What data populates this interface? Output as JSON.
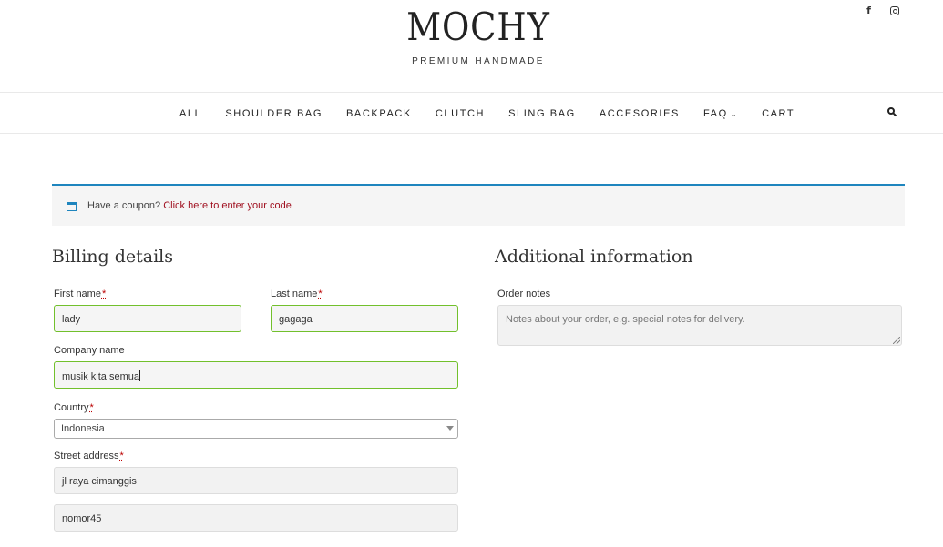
{
  "social": {
    "facebook_icon": "facebook-icon",
    "instagram_icon": "instagram-icon"
  },
  "brand": {
    "name": "MOCHY",
    "tagline": "PREMIUM HANDMADE"
  },
  "nav": {
    "items": [
      {
        "label": "ALL"
      },
      {
        "label": "SHOULDER BAG"
      },
      {
        "label": "BACKPACK"
      },
      {
        "label": "CLUTCH"
      },
      {
        "label": "SLING BAG"
      },
      {
        "label": "ACCESORIES"
      },
      {
        "label": "FAQ",
        "chevron": "⌄"
      },
      {
        "label": "CART"
      }
    ],
    "search_icon": "search-icon"
  },
  "coupon": {
    "text": "Have a coupon?",
    "link": "Click here to enter your code",
    "accent": "#1e85be",
    "link_color": "#a01020"
  },
  "billing": {
    "title": "Billing details",
    "first_name": {
      "label": "First name",
      "required": "*",
      "value": "lady"
    },
    "last_name": {
      "label": "Last name",
      "required": "*",
      "value": "gagaga"
    },
    "company": {
      "label": "Company name",
      "value": "musik kita semua"
    },
    "country": {
      "label": "Country",
      "required": "*",
      "value": "Indonesia"
    },
    "street": {
      "label": "Street address",
      "required": "*",
      "line1": "jl raya cimanggis",
      "line2": "nomor45"
    },
    "valid_color": "#72c02c"
  },
  "additional": {
    "title": "Additional information",
    "order_notes": {
      "label": "Order notes",
      "placeholder": "Notes about your order, e.g. special notes for delivery."
    }
  }
}
